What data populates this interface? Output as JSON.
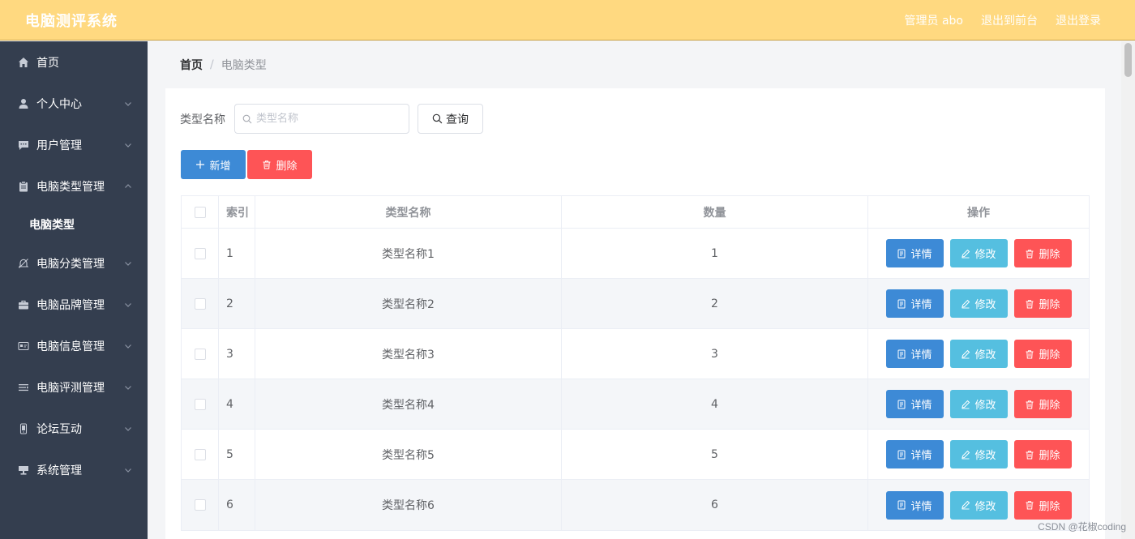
{
  "header": {
    "brand": "电脑测评系统",
    "admin": "管理员 abo",
    "to_frontend": "退出到前台",
    "logout": "退出登录"
  },
  "sidebar": {
    "items": [
      {
        "label": "首页",
        "icon": "home-icon"
      },
      {
        "label": "个人中心",
        "icon": "user-icon"
      },
      {
        "label": "用户管理",
        "icon": "chat-icon"
      },
      {
        "label": "电脑类型管理",
        "icon": "clipboard-icon"
      },
      {
        "label": "电脑分类管理",
        "icon": "bell-off-icon"
      },
      {
        "label": "电脑品牌管理",
        "icon": "briefcase-icon"
      },
      {
        "label": "电脑信息管理",
        "icon": "card-icon"
      },
      {
        "label": "电脑评测管理",
        "icon": "list-icon"
      },
      {
        "label": "论坛互动",
        "icon": "phone-icon"
      },
      {
        "label": "系统管理",
        "icon": "stand-icon"
      }
    ],
    "sub_item": "电脑类型"
  },
  "breadcrumb": {
    "home": "首页",
    "separator": "/",
    "current": "电脑类型"
  },
  "search": {
    "label": "类型名称",
    "placeholder": "类型名称",
    "button": "查询"
  },
  "actions": {
    "add": "新增",
    "delete": "删除"
  },
  "table": {
    "headers": {
      "index": "索引",
      "name": "类型名称",
      "qty": "数量",
      "ops": "操作"
    },
    "op_labels": {
      "detail": "详情",
      "edit": "修改",
      "delete": "删除"
    },
    "rows": [
      {
        "index": "1",
        "name": "类型名称1",
        "qty": "1"
      },
      {
        "index": "2",
        "name": "类型名称2",
        "qty": "2"
      },
      {
        "index": "3",
        "name": "类型名称3",
        "qty": "3"
      },
      {
        "index": "4",
        "name": "类型名称4",
        "qty": "4"
      },
      {
        "index": "5",
        "name": "类型名称5",
        "qty": "5"
      },
      {
        "index": "6",
        "name": "类型名称6",
        "qty": "6"
      }
    ]
  },
  "watermark": "CSDN @花椒coding",
  "colors": {
    "header_bg": "#ffd980",
    "sidebar_bg": "#343e4f",
    "primary": "#3d8ad6",
    "info": "#55bfe0",
    "danger": "#fe5456"
  }
}
